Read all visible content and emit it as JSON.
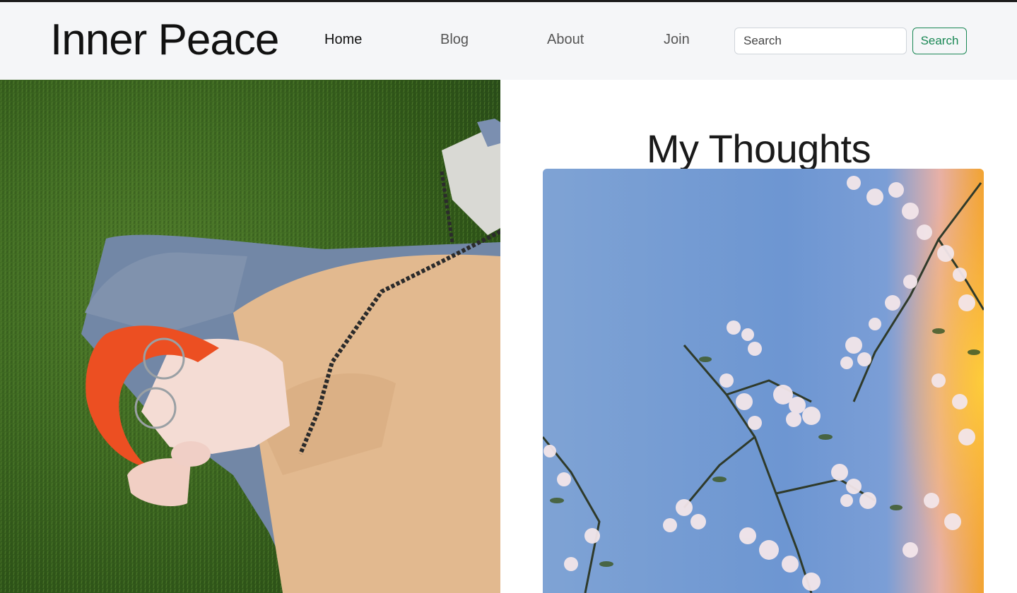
{
  "navbar": {
    "brand": "Inner Peace",
    "links": [
      "Home",
      "Blog",
      "About",
      "Join"
    ],
    "active": "Home",
    "search_placeholder": "Search",
    "search_button": "Search"
  },
  "main": {
    "title": "My Thoughts"
  },
  "colors": {
    "navbar_bg": "#f5f6f8",
    "accent_green": "#198754"
  }
}
